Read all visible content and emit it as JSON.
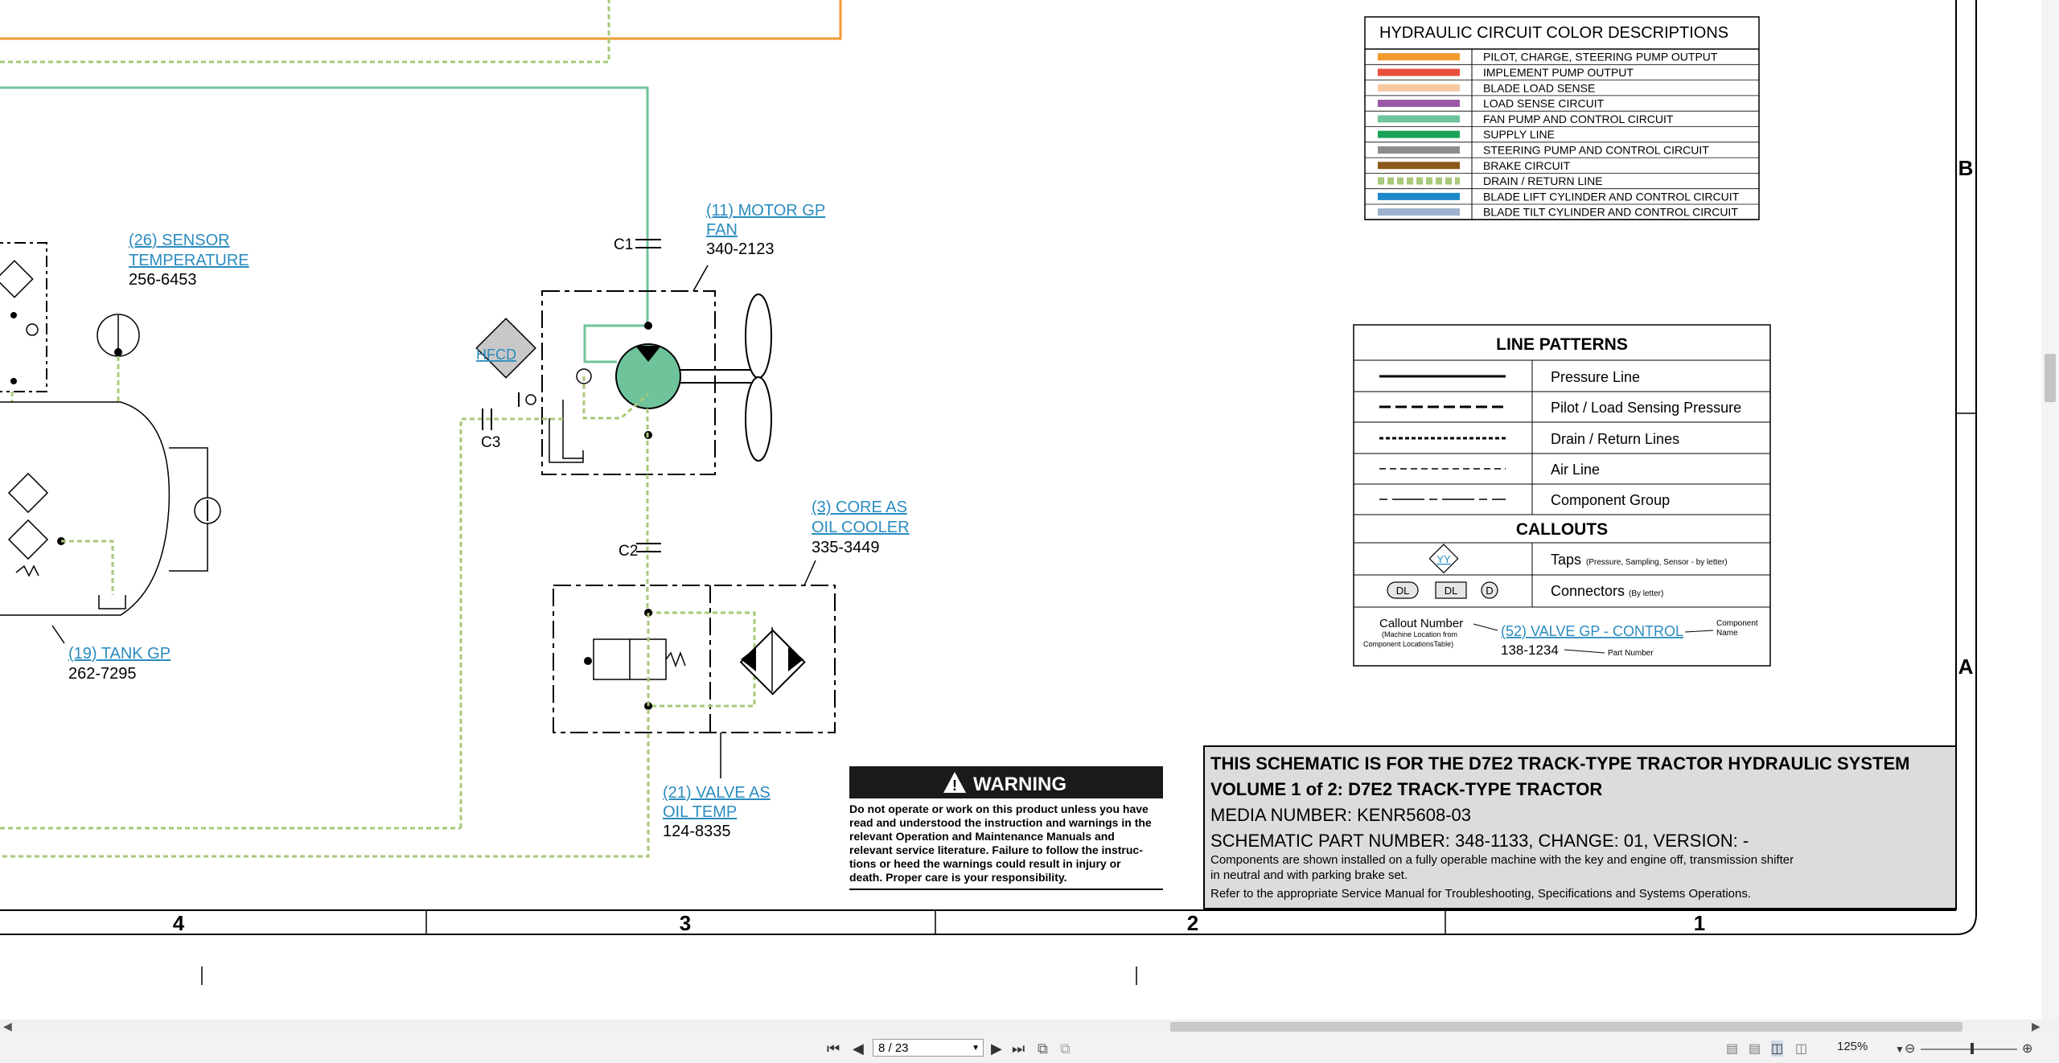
{
  "colors": {
    "pilot": "#f29a2e",
    "implement": "#e8503c",
    "blade_load": "#f7c9a0",
    "load_sense": "#9b5aa8",
    "fan": "#6fc39b",
    "supply": "#1aa35a",
    "steering": "#8c8c8c",
    "brake": "#8b5a1b",
    "drain": "#a8c97a",
    "blade_lift": "#1b88c8",
    "blade_tilt": "#9db3cf",
    "link": "#2a8bbf"
  },
  "color_table": {
    "title": "HYDRAULIC CIRCUIT COLOR DESCRIPTIONS",
    "rows": [
      {
        "label": "PILOT, CHARGE, STEERING PUMP OUTPUT",
        "color": "#f29a2e"
      },
      {
        "label": "IMPLEMENT PUMP OUTPUT",
        "color": "#e8503c"
      },
      {
        "label": "BLADE LOAD SENSE",
        "color": "#f7c9a0"
      },
      {
        "label": "LOAD SENSE CIRCUIT",
        "color": "#9b5aa8"
      },
      {
        "label": "FAN PUMP AND CONTROL CIRCUIT",
        "color": "#6fc39b"
      },
      {
        "label": "SUPPLY LINE",
        "color": "#1aa35a"
      },
      {
        "label": "STEERING PUMP AND CONTROL CIRCUIT",
        "color": "#8c8c8c"
      },
      {
        "label": "BRAKE CIRCUIT",
        "color": "#8b5a1b"
      },
      {
        "label": "DRAIN / RETURN LINE",
        "color": "#a8c97a"
      },
      {
        "label": "BLADE LIFT CYLINDER AND CONTROL CIRCUIT",
        "color": "#1b88c8"
      },
      {
        "label": "BLADE TILT CYLINDER AND CONTROL CIRCUIT",
        "color": "#9db3cf"
      }
    ]
  },
  "line_patterns": {
    "title": "LINE PATTERNS",
    "rows": [
      "Pressure Line",
      "Pilot / Load Sensing Pressure",
      "Drain / Return Lines",
      "Air Line",
      "Component Group"
    ],
    "callouts_title": "CALLOUTS",
    "taps_label": "Taps",
    "taps_note": "(Pressure, Sampling, Sensor - by letter)",
    "taps_symbol": "YY",
    "connectors_label": "Connectors",
    "connectors_note": "(By letter)",
    "conn_a": "DL",
    "conn_b": "DL",
    "conn_c": "D",
    "callout_number": "Callout Number",
    "callout_note1": "(Machine Location from",
    "callout_note2": "Component LocationsTable)",
    "example_link": "(52) VALVE GP - CONTROL",
    "example_part": "138-1234",
    "component_name1": "Component",
    "component_name2": "Name",
    "part_number": "Part Number"
  },
  "components": {
    "sensor": {
      "line1": "(26) SENSOR",
      "line2": "TEMPERATURE",
      "part": "256-6453"
    },
    "motor": {
      "line1": "(11) MOTOR GP",
      "line2": "FAN",
      "part": "340-2123"
    },
    "cooler": {
      "line1": "(3) CORE AS",
      "line2": "OIL COOLER",
      "part": "335-3449"
    },
    "tank": {
      "line1": "(19) TANK GP",
      "part": "262-7295"
    },
    "valve": {
      "line1": "(21) VALVE AS",
      "line2": "OIL TEMP",
      "part": "124-8335"
    },
    "hfcd": "HFCD",
    "c1": "C1",
    "c2": "C2",
    "c3": "C3"
  },
  "warning": {
    "title": "WARNING",
    "lines": [
      "Do not operate or work on this product unless you have",
      "read and understood the instruction and warnings in the",
      "relevant Operation and Maintenance Manuals and",
      "relevant service literature. Failure to follow the instruc-",
      "tions or heed the warnings could result in injury or",
      "death. Proper care is your responsibility."
    ]
  },
  "title_block": {
    "line1": "THIS SCHEMATIC IS FOR THE D7E2 TRACK-TYPE TRACTOR HYDRAULIC SYSTEM",
    "line2": "VOLUME 1 of 2: D7E2 TRACK-TYPE TRACTOR",
    "media": "MEDIA NUMBER: KENR5608-03",
    "part": "SCHEMATIC PART NUMBER: 348-1133, CHANGE: 01, VERSION: -",
    "note1": "Components are shown installed on a fully operable machine with the key and engine off, transmission shifter",
    "note2": "in neutral and with parking brake set.",
    "note3": "Refer to the appropriate Service Manual for Troubleshooting, Specifications and Systems Operations."
  },
  "grid": {
    "columns": [
      "4",
      "3",
      "2",
      "1"
    ],
    "rows": [
      "B",
      "A"
    ]
  },
  "viewer": {
    "page": "8 / 23",
    "zoom": "125%"
  }
}
